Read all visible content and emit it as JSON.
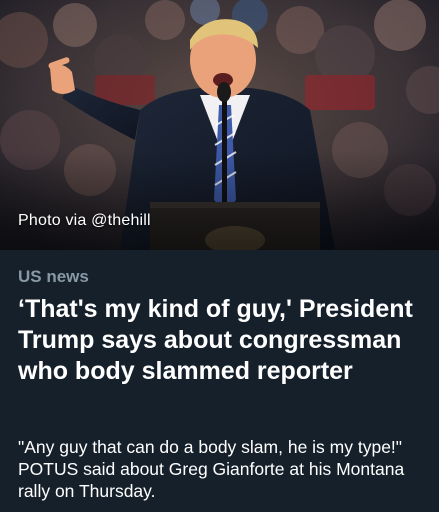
{
  "article": {
    "photo_credit": "Photo via @thehill",
    "category": "US news",
    "headline": "‘That's my kind of guy,' President Trump says about congressman who body slammed reporter",
    "description": "\"Any guy that can do a body slam, he is my type!\" POTUS said about Greg Gianforte at his Montana rally on Thursday."
  },
  "colors": {
    "background": "#15202b",
    "category_text": "#8899a6",
    "headline_text": "#ffffff",
    "body_text": "#ffffff"
  },
  "icons": {
    "hero": "photo-of-speaker-at-podium"
  }
}
